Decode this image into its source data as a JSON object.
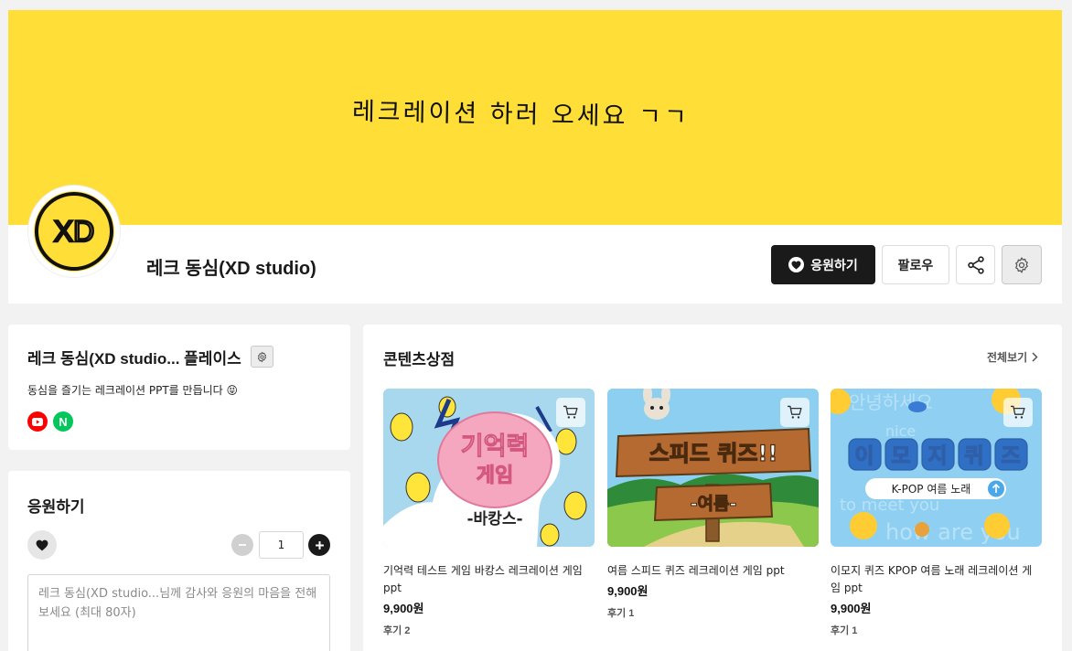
{
  "banner": {
    "text": "레크레이션 하러 오세요 ㄱㄱ"
  },
  "profile": {
    "name": "레크 동심(XD studio)",
    "logo_text": "XD",
    "support_button": "응원하기",
    "follow_button": "팔로우"
  },
  "place": {
    "title": "레크 동심(XD studio... 플레이스",
    "description": "동심을 즐기는 레크레이션 PPT를 만듭니다 😝",
    "social_links": [
      {
        "name": "youtube",
        "color": "#ff0000"
      },
      {
        "name": "naver",
        "label": "N",
        "color": "#03c75a"
      }
    ]
  },
  "support": {
    "title": "응원하기",
    "quantity": "1",
    "message_placeholder": "레크 동심(XD studio...님께 감사와 응원의 마음을 전해보세요 (최대 80자)"
  },
  "shop": {
    "title": "콘텐츠상점",
    "view_all": "전체보기",
    "products": [
      {
        "title": "기억력 테스트 게임 바캉스 레크레이션 게임 ppt",
        "price": "9,900원",
        "reviews": "후기 2",
        "thumb_text": [
          "기억력",
          "게임"
        ],
        "thumb_sub": "-바캉스-"
      },
      {
        "title": "여름 스피드 퀴즈 레크레이션 게임 ppt",
        "price": "9,900원",
        "reviews": "후기 1",
        "thumb_text": "스피드 퀴즈!!",
        "thumb_sub": "-여름-"
      },
      {
        "title": "이모지 퀴즈 KPOP 여름 노래 레크레이션 게임 ppt",
        "price": "9,900원",
        "reviews": "후기 1",
        "thumb_text": [
          "이",
          "모",
          "지",
          "퀴",
          "즈"
        ],
        "thumb_sub": "K-POP 여름 노래",
        "thumb_bg": [
          "안녕하세요",
          "nice",
          "to meet you",
          "how are you"
        ]
      }
    ]
  },
  "colors": {
    "banner": "#ffde38",
    "primary_button": "#1a1a1a",
    "youtube": "#ff0000",
    "naver": "#03c75a"
  }
}
